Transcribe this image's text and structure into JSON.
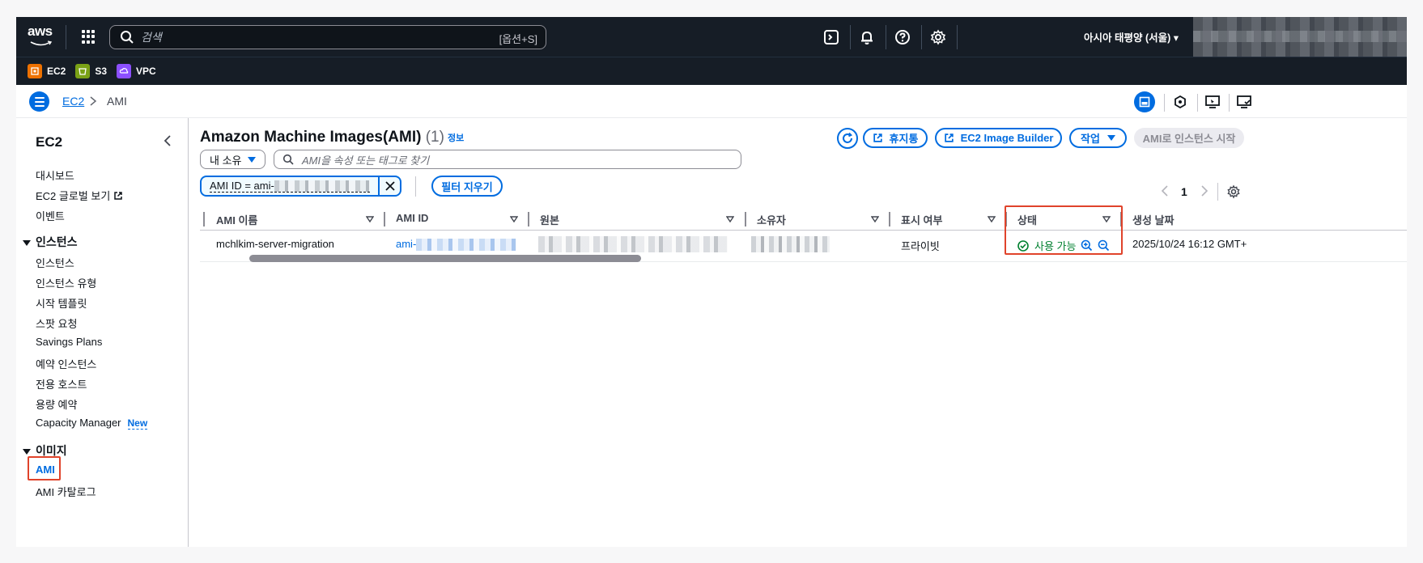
{
  "topnav": {
    "search_placeholder": "검색",
    "search_shortcut": "[옵션+S]",
    "region": "아시아 태평양 (서울)"
  },
  "favorites": [
    {
      "label": "EC2",
      "color": "#ed7100"
    },
    {
      "label": "S3",
      "color": "#7aa116"
    },
    {
      "label": "VPC",
      "color": "#8c4fff"
    }
  ],
  "breadcrumb": {
    "root": "EC2",
    "current": "AMI"
  },
  "sidebar": {
    "title": "EC2",
    "top_items": [
      "대시보드",
      "EC2 글로벌 보기",
      "이벤트"
    ],
    "instances_section": "인스턴스",
    "instances_items": [
      "인스턴스",
      "인스턴스 유형",
      "시작 템플릿",
      "스팟 요청",
      "Savings Plans",
      "예약 인스턴스",
      "전용 호스트",
      "용량 예약",
      "Capacity Manager"
    ],
    "new_badge": "New",
    "images_section": "이미지",
    "images_items": [
      "AMI",
      "AMI 카탈로그"
    ]
  },
  "main": {
    "title": "Amazon Machine Images(AMI)",
    "count": "(1)",
    "info": "정보",
    "buttons": {
      "recycle_bin": "휴지통",
      "image_builder": "EC2 Image Builder",
      "actions": "작업",
      "launch": "AMI로 인스턴스 시작"
    },
    "ownership_select": "내 소유",
    "search_placeholder": "AMI을 속성 또는 태그로 찾기",
    "filter_token": "AMI ID = ami-",
    "clear_filters": "필터 지우기",
    "page": "1"
  },
  "table": {
    "columns": [
      "AMI 이름",
      "AMI ID",
      "원본",
      "소유자",
      "표시 여부",
      "상태",
      "생성 날짜"
    ],
    "rows": [
      {
        "name": "mchlkim-server-migration",
        "ami_id_prefix": "ami-",
        "visibility": "프라이빗",
        "status": "사용 가능",
        "created": "2025/10/24 16:12 GMT+"
      }
    ]
  },
  "colors": {
    "accent": "#006ce0",
    "success": "#00802f",
    "highlight": "#e0432b",
    "nav_bg": "#161d26"
  }
}
